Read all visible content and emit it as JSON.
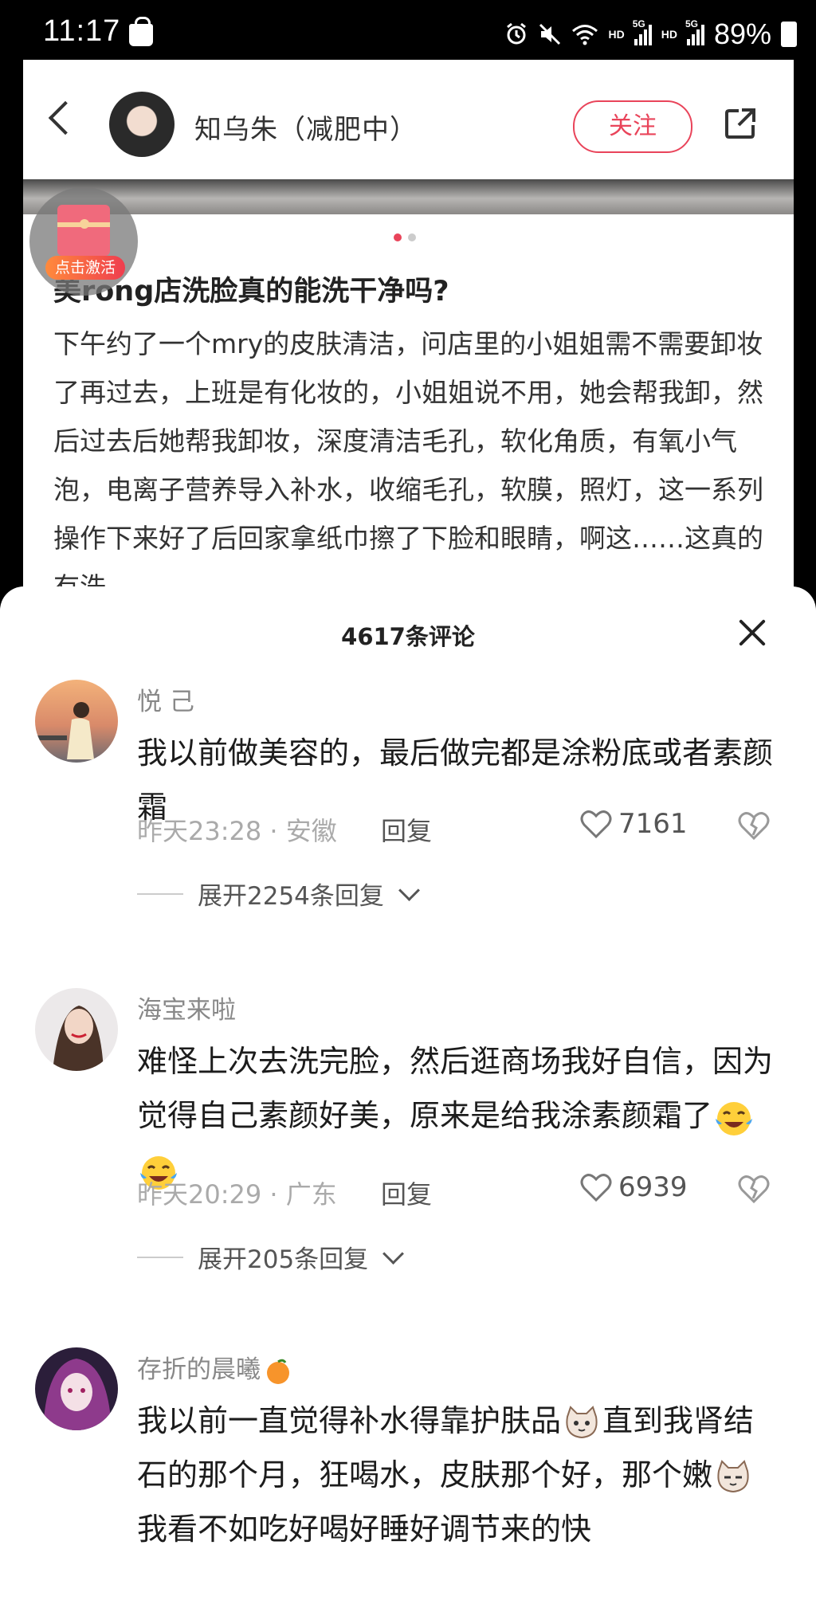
{
  "status_bar": {
    "time": "11:17",
    "battery": "89%",
    "hd1": "HD",
    "hd2": "HD",
    "net1": "5G",
    "net2": "5G"
  },
  "post": {
    "author": "知乌朱（减肥中）",
    "follow_label": "关注",
    "redpacket_label": "点击激活",
    "title": "美rong店洗脸真的能洗干净吗?",
    "body": "下午约了一个mry的皮肤清洁，问店里的小姐姐需不需要卸妆了再过去，上班是有化妆的，小姐姐说不用，她会帮我卸，然后过去后她帮我卸妆，深度清洁毛孔，软化角质，有氧小气泡，电离子营养导入补水，收缩毛孔，软膜，照灯，这一系列操作下来好了后回家拿纸巾擦了下脸和眼睛，啊这……这真的有洗"
  },
  "comments_sheet": {
    "title": "4617条评论",
    "comments": [
      {
        "user": "悦 己",
        "text": "我以前做美容的，最后做完都是涂粉底或者素颜霜",
        "meta": "昨天23:28 · 安徽",
        "reply_label": "回复",
        "likes": "7161",
        "expand": "展开2254条回复"
      },
      {
        "user": "海宝来啦",
        "text": "难怪上次去洗完脸，然后逛商场我好自信，因为觉得自己素颜好美，原来是给我涂素颜霜了",
        "meta": "昨天20:29 · 广东",
        "reply_label": "回复",
        "likes": "6939",
        "expand": "展开205条回复"
      },
      {
        "user": "存折的晨曦",
        "text_part1": "我以前一直觉得补水得靠护肤品",
        "text_part2": "直到我肾结石的那个月，狂喝水，皮肤那个好，那个嫩",
        "text_part3": "我看不如吃好喝好睡好调节来的快"
      }
    ]
  },
  "colors": {
    "accent": "#e9445a",
    "meta_gray": "#aaaaaa"
  }
}
